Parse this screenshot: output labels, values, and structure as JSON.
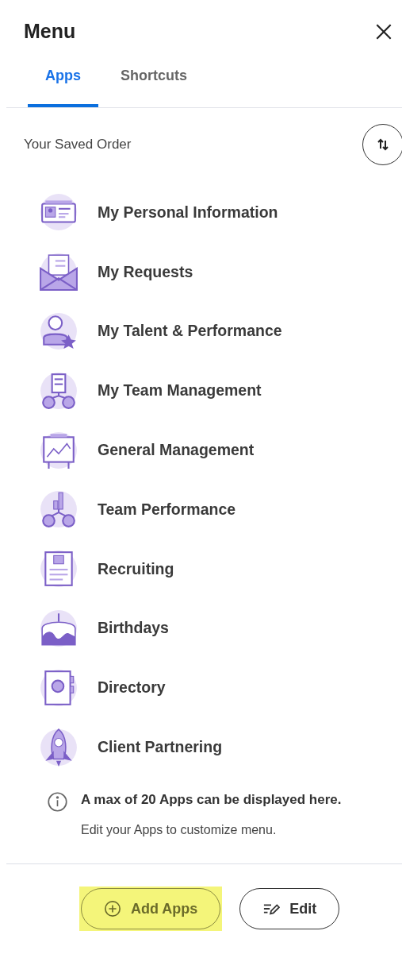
{
  "header": {
    "title": "Menu"
  },
  "tabs": [
    {
      "label": "Apps",
      "selected": true
    },
    {
      "label": "Shortcuts",
      "selected": false
    }
  ],
  "section": {
    "title": "Your Saved Order"
  },
  "apps": [
    {
      "label": "My Personal Information",
      "kind": "id-card"
    },
    {
      "label": "My Requests",
      "kind": "envelope"
    },
    {
      "label": "My Talent & Performance",
      "kind": "person-star"
    },
    {
      "label": "My Team Management",
      "kind": "team-board"
    },
    {
      "label": "General Management",
      "kind": "easel"
    },
    {
      "label": "Team Performance",
      "kind": "team-chart"
    },
    {
      "label": "Recruiting",
      "kind": "resume"
    },
    {
      "label": "Birthdays",
      "kind": "cake"
    },
    {
      "label": "Directory",
      "kind": "address-book"
    },
    {
      "label": "Client Partnering",
      "kind": "rocket"
    }
  ],
  "notice": {
    "title": "A max of 20 Apps can be displayed here.",
    "text": "Edit your Apps to customize menu."
  },
  "buttons": [
    {
      "label": "Add Apps",
      "kind": "add",
      "highlighted": true
    },
    {
      "label": "Edit",
      "kind": "edit",
      "highlighted": false
    }
  ]
}
